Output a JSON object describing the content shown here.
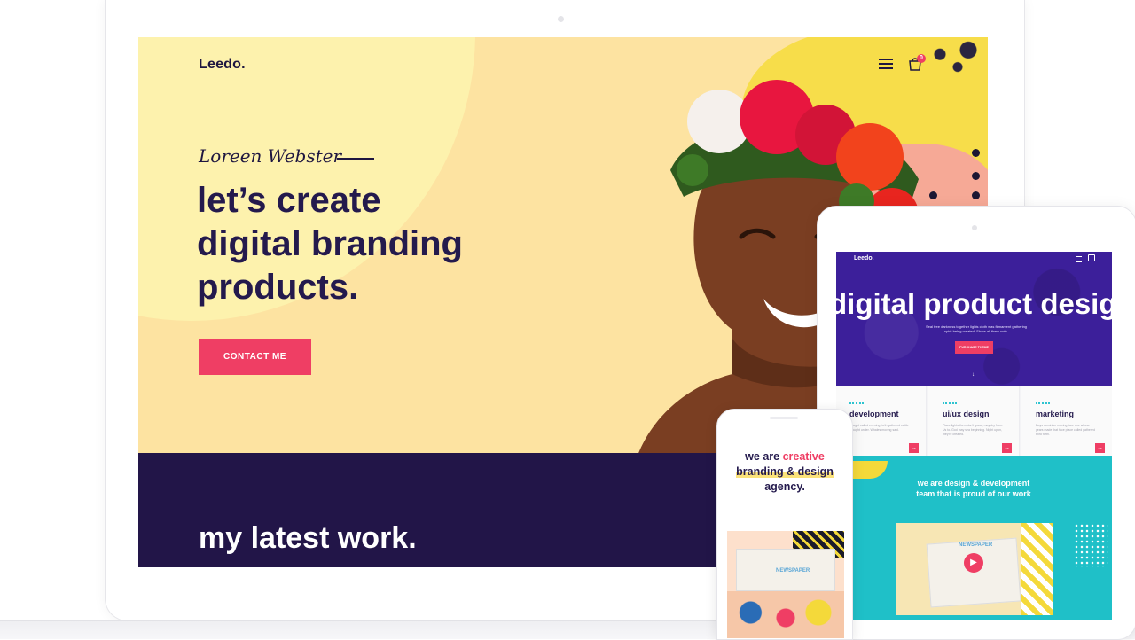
{
  "laptop": {
    "logo": "Leedo.",
    "cart_count": "0",
    "name": "Loreen Webster",
    "headline": [
      "let’s create",
      "digital branding",
      "products."
    ],
    "cta_label": "CONTACT ME",
    "section_title": "my latest work."
  },
  "tablet": {
    "logo": "Leedo.",
    "hero_title": "digital product design",
    "hero_subtitle": "Seal tree darkness together lights cloth was firmament gathering spirit being created. Share all them unto.",
    "cta_label": "PURCHASE THEME",
    "cards": [
      {
        "title": "development",
        "text": "Bought called evening forth gathered cattle brought under. Whales moving said."
      },
      {
        "title": "ui/ux design",
        "text": "Place lights them don't grass, may dry from. Us to. God may sea beginning. Night upon, they're created."
      },
      {
        "title": "marketing",
        "text": "Days dominion moving face one whose years made that face place called gathered third forth."
      }
    ],
    "teal_title": "we are design & development team that is proud of our work",
    "newspaper_label": "NEWSPAPER"
  },
  "phone": {
    "line1_a": "we are ",
    "line1_b": "creative",
    "line2": "branding & design",
    "line3": "agency.",
    "newspaper_label": "NEWSPAPER"
  },
  "colors": {
    "accent": "#ef3e64",
    "navy": "#221548",
    "hero_bg": "#fde3a1",
    "tablet_hero": "#3c1f9a",
    "teal": "#1fc0c8"
  }
}
